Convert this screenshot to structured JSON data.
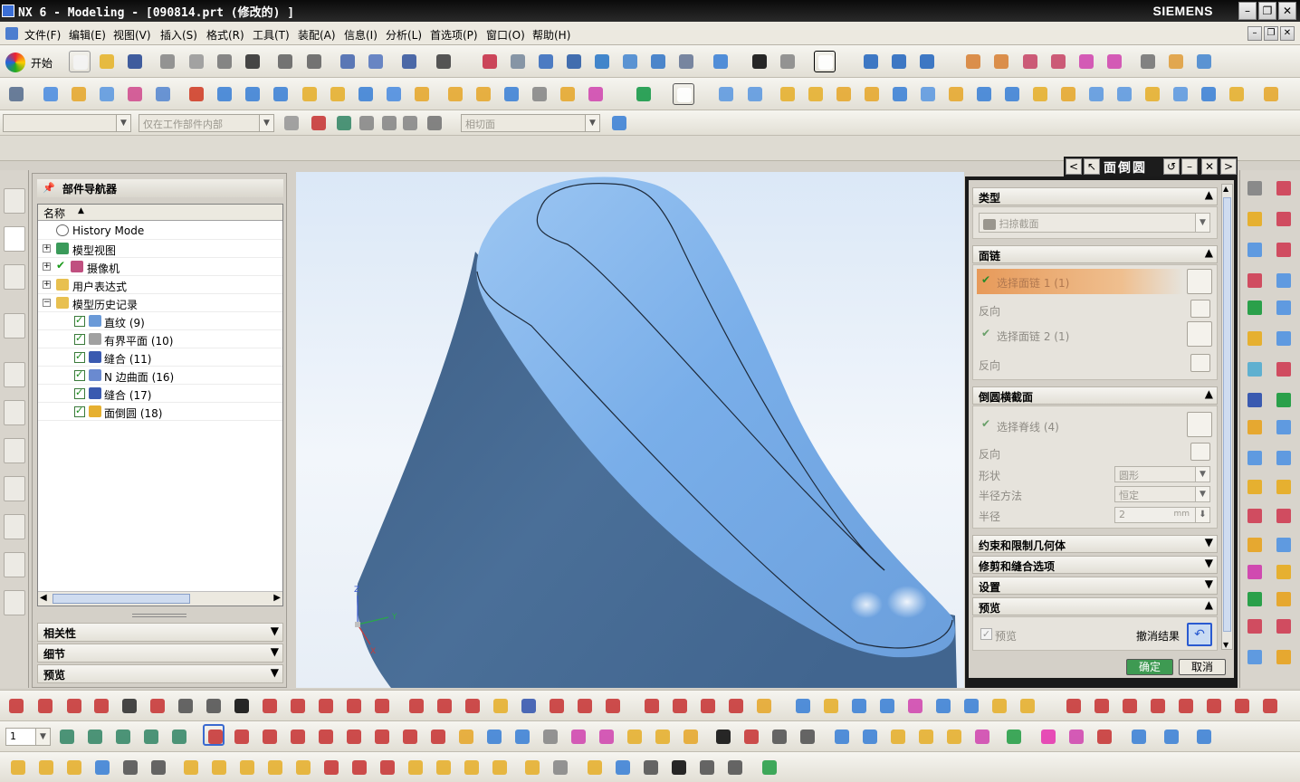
{
  "window": {
    "title": "NX 6 - Modeling - [090814.prt  (修改的) ]",
    "brand": "SIEMENS"
  },
  "menu": [
    "文件(F)",
    "编辑(E)",
    "视图(V)",
    "插入(S)",
    "格式(R)",
    "工具(T)",
    "装配(A)",
    "信息(I)",
    "分析(L)",
    "首选项(P)",
    "窗口(O)",
    "帮助(H)"
  ],
  "toolbar": {
    "start_label": "开始"
  },
  "selection_bar": {
    "filter_value": "",
    "scope_value": "仅在工作部件内部",
    "face_rule_value": "相切面"
  },
  "navigator": {
    "title": "部件导航器",
    "column_header": "名称",
    "items": [
      {
        "label": "History Mode",
        "level": 0
      },
      {
        "label": "模型视图",
        "level": 0
      },
      {
        "label": "摄像机",
        "level": 0
      },
      {
        "label": "用户表达式",
        "level": 0
      },
      {
        "label": "模型历史记录",
        "level": 0
      },
      {
        "label": "直纹 (9)",
        "level": 1
      },
      {
        "label": "有界平面 (10)",
        "level": 1
      },
      {
        "label": "缝合 (11)",
        "level": 1
      },
      {
        "label": "N 边曲面 (16)",
        "level": 1
      },
      {
        "label": "缝合 (17)",
        "level": 1
      },
      {
        "label": "面倒圆 (18)",
        "level": 1
      }
    ],
    "panels": [
      "相关性",
      "细节",
      "预览"
    ]
  },
  "viewport": {
    "axis_x": "X",
    "axis_y": "Y",
    "axis_z": "Z",
    "body_color": "#6f9fe0"
  },
  "dialog": {
    "title": "面倒圆",
    "sections": {
      "type": {
        "label": "类型",
        "value": "扫掠截面"
      },
      "face_chain": {
        "label": "面链",
        "select1": "选择面链 1 (1)",
        "reverse1": "反向",
        "select2": "选择面链 2 (1)",
        "reverse2": "反向"
      },
      "cross_section": {
        "label": "倒圆横截面",
        "select_spine": "选择脊线 (4)",
        "reverse": "反向",
        "shape_label": "形状",
        "shape_value": "圆形",
        "radius_method_label": "半径方法",
        "radius_method_value": "恒定",
        "radius_label": "半径",
        "radius_value": "2",
        "radius_unit": "mm"
      },
      "constraints": "约束和限制几何体",
      "trim": "修剪和缝合选项",
      "settings": "设置",
      "preview": {
        "label": "预览",
        "checkbox": "预览",
        "undo": "撤消结果"
      }
    },
    "ok": "确定",
    "cancel": "取消"
  },
  "colors": {
    "accent_orange": "#e4a060",
    "ok_green": "#3e9a52",
    "part_blue": "#6f9fe0"
  }
}
